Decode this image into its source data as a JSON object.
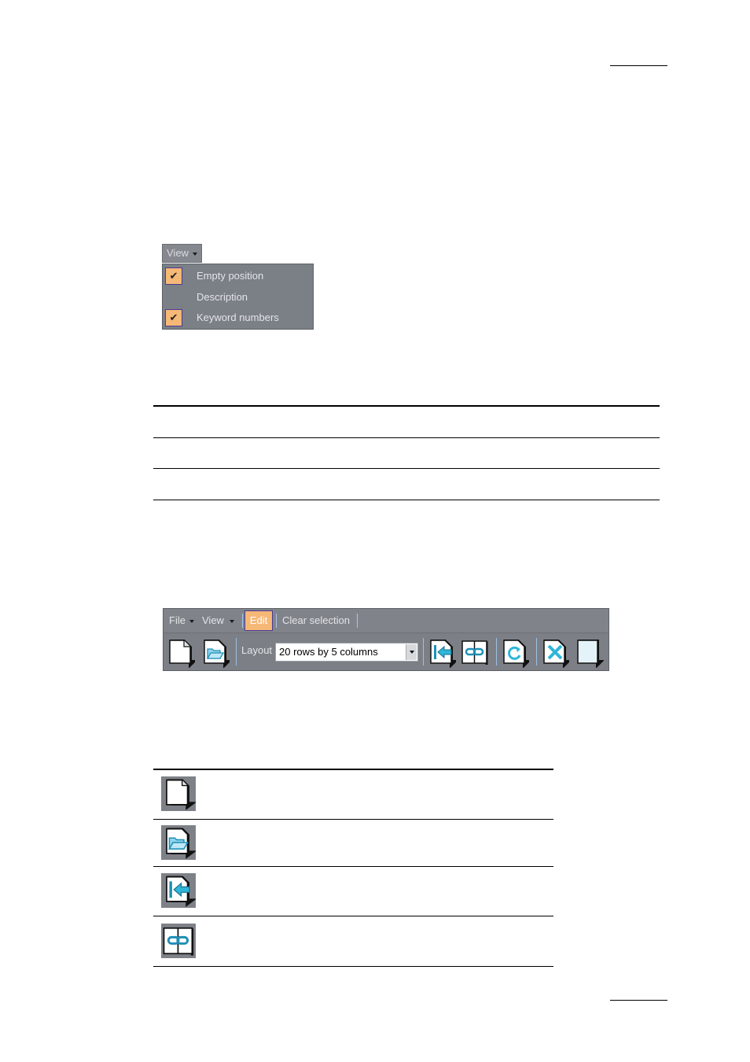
{
  "view_menu": {
    "header": "View",
    "items": [
      {
        "label": "Empty position",
        "checked": true,
        "check_glyph": "✔"
      },
      {
        "label": "Description",
        "checked": false,
        "check_glyph": ""
      },
      {
        "label": "Keyword numbers",
        "checked": true,
        "check_glyph": "✔"
      }
    ]
  },
  "toolbar": {
    "menus": {
      "file": "File",
      "view": "View",
      "edit": "Edit",
      "clear_selection": "Clear selection"
    },
    "layout_label": "Layout",
    "layout_value": "20 rows by 5 columns",
    "buttons": [
      "new-page-icon",
      "open-folder-icon",
      "insert-icon",
      "link-icon",
      "refresh-icon",
      "delete-icon",
      "blank-page-icon"
    ]
  },
  "icon_table": {
    "rows": [
      "new-page-icon",
      "open-folder-icon",
      "insert-icon",
      "link-icon"
    ]
  },
  "colors": {
    "panel_gray": "#7b7f86",
    "check_orange": "#f6b877",
    "icon_blue": "#2fb6d9",
    "separator_blue": "#9cc0e3"
  }
}
